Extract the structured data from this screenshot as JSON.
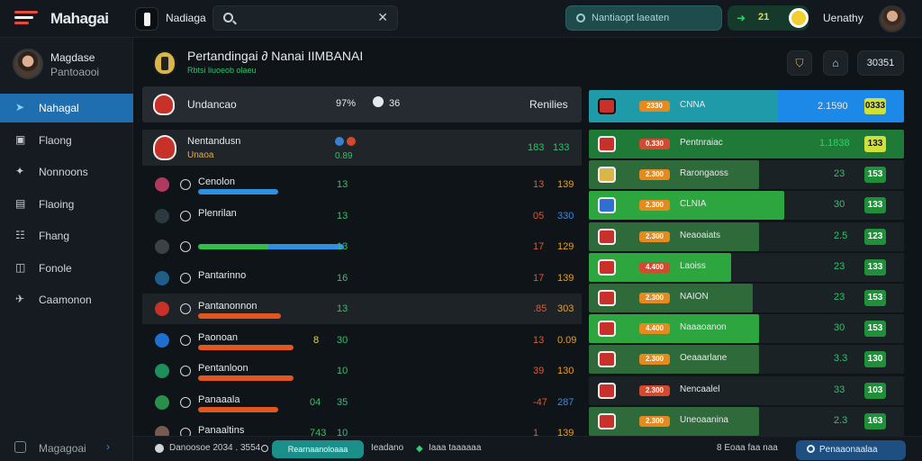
{
  "app": {
    "title": "Mahagai",
    "club_name": "Nadiaga"
  },
  "search": {
    "value": "",
    "placeholder": ""
  },
  "search2": {
    "label": "Nantiaopt laeaten"
  },
  "coins": {
    "value": "21"
  },
  "user": {
    "name": "Uenathy"
  },
  "sidebar": {
    "profile": {
      "name": "Magdase",
      "subtitle": "Pantoaooi"
    },
    "items": [
      {
        "label": "Nahagal",
        "icon": "navigation-icon",
        "active": true
      },
      {
        "label": "Flaong",
        "icon": "inbox-icon"
      },
      {
        "label": "Nonnoons",
        "icon": "gear-icon"
      },
      {
        "label": "Flaoing",
        "icon": "chart-icon"
      },
      {
        "label": "Fhang",
        "icon": "tactics-icon"
      },
      {
        "label": "Fonole",
        "icon": "folder-icon"
      },
      {
        "label": "Caamonon",
        "icon": "send-icon"
      }
    ],
    "bottom": {
      "label": "Magagoai"
    }
  },
  "header": {
    "title": "Pertandingai ∂ Nanai IIMBANAI",
    "subtitle": "Rbtsi liuoeob olaeu",
    "score": "30351"
  },
  "left_panel": {
    "head": {
      "name": "Undancao",
      "stat1": "97%",
      "stat2": "36",
      "col": "Renilies"
    },
    "featured": {
      "name": "Nentandusn",
      "sub": "Unaoa",
      "v1": "0.89",
      "r1": "183",
      "r2": "133"
    },
    "rows": [
      {
        "name": "Cenolon",
        "mid": "13",
        "v1": "13",
        "v2": "139",
        "v2color": "#e8a11f",
        "barColor": "#2f8fe0",
        "bar": 0.27
      },
      {
        "name": "Plenrilan",
        "mid": "13",
        "v1": "05",
        "v2": "330",
        "v2color": "#3d8ae0",
        "barColor": "",
        "bar": 0
      },
      {
        "name": "",
        "mid": "13",
        "v1": "17",
        "v2": "129",
        "v2color": "#e8a11f",
        "barColor": "#2f8fe0",
        "bar": 0.49
      },
      {
        "name": "Pantarinno",
        "mid": "16",
        "v1": "17",
        "v2": "139",
        "v2color": "#e8a11f",
        "barColor": "",
        "bar": 0
      },
      {
        "name": "Pantanonnon",
        "mid": "13",
        "v1": ".85",
        "v2": "303",
        "v2color": "#e8a11f",
        "barColor": "#e0581f",
        "bar": 0.28
      },
      {
        "name": "Paonoan",
        "mid": "30",
        "v1": "13",
        "v2": "0.09",
        "v2color": "#e8a11f",
        "barColor": "#e0581f",
        "bar": 0.32,
        "extra": "8"
      },
      {
        "name": "Pentanloon",
        "mid": "10",
        "v1": "39",
        "v2": "130",
        "v2color": "#e8a11f",
        "barColor": "#e0581f",
        "bar": 0.32
      },
      {
        "name": "Panaaala",
        "mid": "35",
        "v1": "-47",
        "v2": "287",
        "v2color": "#3d8ae0",
        "barColor": "#e0581f",
        "bar": 0.27,
        "extra": "04"
      },
      {
        "name": "Panaaltins",
        "mid": "10",
        "v1": "1",
        "v2": "139",
        "v2color": "#e8a11f",
        "barColor": "",
        "bar": 0,
        "extra": "743"
      }
    ]
  },
  "right_panel": {
    "head": {
      "chip": "2330",
      "name": "CNNA",
      "v1": "2.1590",
      "v2": "0333"
    },
    "rows": [
      {
        "chip": "0.330",
        "name": "Pentnraiac",
        "v1": "1.1838",
        "v2": "133",
        "chipColor": "#d44a2e",
        "fill": 0,
        "highlight": true
      },
      {
        "chip": "2.300",
        "name": "Rarongaoss",
        "v1": "23",
        "v2": "153",
        "chipColor": "#e48a1f",
        "fill": 0.54
      },
      {
        "chip": "2.300",
        "name": "CLNIA",
        "v1": "30",
        "v2": "133",
        "chipColor": "#e48a1f",
        "fill": 0.62
      },
      {
        "chip": "2.300",
        "name": "Neaoaiats",
        "v1": "2.5",
        "v2": "123",
        "chipColor": "#e48a1f",
        "fill": 0.54
      },
      {
        "chip": "4.400",
        "name": "Laoiss",
        "v1": "23",
        "v2": "133",
        "chipColor": "#d44a2e",
        "fill": 0.45
      },
      {
        "chip": "2.300",
        "name": "NAION",
        "v1": "23",
        "v2": "153",
        "chipColor": "#e48a1f",
        "fill": 0.52
      },
      {
        "chip": "4.400",
        "name": "Naaaoanon",
        "v1": "30",
        "v2": "153",
        "chipColor": "#e48a1f",
        "fill": 0.54
      },
      {
        "chip": "2.300",
        "name": "Oeaaarlane",
        "v1": "3.3",
        "v2": "130",
        "chipColor": "#e48a1f",
        "fill": 0.54
      },
      {
        "chip": "2.300",
        "name": "Nencaalel",
        "v1": "33",
        "v2": "103",
        "chipColor": "#d44a2e",
        "fill": 0
      },
      {
        "chip": "2.300",
        "name": "Uneoaanina",
        "v1": "2.3",
        "v2": "163",
        "chipColor": "#e48a1f",
        "fill": 0.54
      }
    ]
  },
  "bottombar": {
    "item1": "Danoosoe 2034 . 3554",
    "pill": "Rearnaanoloaaa",
    "item2": "Ieadano",
    "item3": "Iaaa taaaaaa",
    "item4": "8 Eoaa faa naa",
    "button": "Penaaonaalaa"
  }
}
